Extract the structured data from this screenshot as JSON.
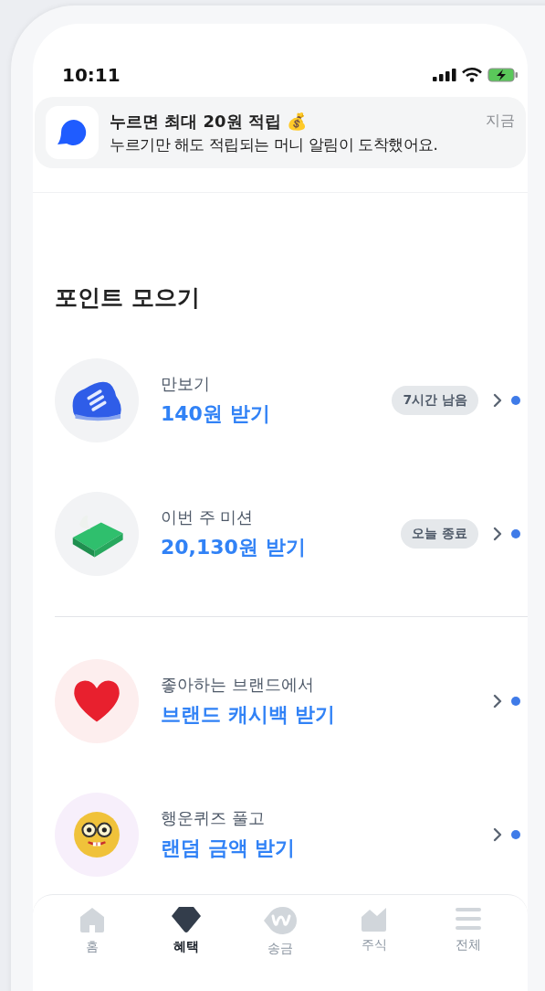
{
  "status_bar": {
    "time": "10:11"
  },
  "notification": {
    "title": "누르면 최대 20원 적립 💰",
    "time": "지금",
    "body": "누르기만 해도 적립되는 머니 알림이 도착했어요."
  },
  "section_title": "포인트 모으기",
  "groups": [
    {
      "items": [
        {
          "kind": "shoe",
          "label": "만보기",
          "reward": "140원 받기",
          "badge": "7시간 남음"
        },
        {
          "kind": "money",
          "label": "이번 주 미션",
          "reward": "20,130원 받기",
          "badge": "오늘 종료"
        }
      ]
    },
    {
      "items": [
        {
          "kind": "heart",
          "label": "좋아하는 브랜드에서",
          "reward": "브랜드 캐시백 받기"
        },
        {
          "kind": "face",
          "label": "행운퀴즈 풀고",
          "reward": "랜덤 금액 받기"
        }
      ]
    }
  ],
  "tabs": [
    {
      "kind": "home",
      "label": "홈",
      "selected": false
    },
    {
      "kind": "gem",
      "label": "혜택",
      "selected": true
    },
    {
      "kind": "won",
      "label": "송금",
      "selected": false
    },
    {
      "kind": "chart",
      "label": "주식",
      "selected": false
    },
    {
      "kind": "menu",
      "label": "전체",
      "selected": false
    }
  ]
}
